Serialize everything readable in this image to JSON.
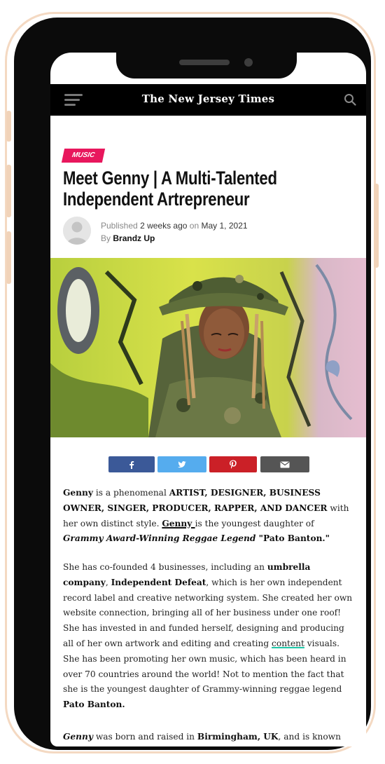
{
  "site": {
    "logo": "The New Jersey Times"
  },
  "article": {
    "category": "MUSIC",
    "title_line1": "Meet Genny | A Multi-Talented",
    "title_line2": "Independent Artrepreneur",
    "meta": {
      "published_prefix": "Published",
      "relative_time": "2 weeks ago",
      "on_word": "on",
      "date": "May 1, 2021",
      "by_prefix": "By",
      "author": "Brandz Up"
    },
    "share_buttons": [
      {
        "name": "facebook",
        "color": "#3b5998"
      },
      {
        "name": "twitter",
        "color": "#55acee"
      },
      {
        "name": "pinterest",
        "color": "#cb2027"
      },
      {
        "name": "email",
        "color": "#555555"
      }
    ],
    "p1": {
      "s1": "Genny",
      "s2": " is a phenomenal ",
      "s3": "ARTIST, DESIGNER, BUSINESS OWNER, SINGER, PRODUCER, RAPPER, AND DANCER",
      "s4": " with her own distinct style. ",
      "s5": "Genny ",
      "s6": "is the youngest daughter of ",
      "s7": "Grammy Award-Winning Reggae Legend",
      "s8": " \"Pato Banton.\""
    },
    "p2": {
      "s1": "She has co-founded 4 businesses, including an ",
      "s2": "umbrella company",
      "s3": ", ",
      "s4": "Independent Defeat",
      "s5": ", which is her own independent record label and creative networking system. She created her own website connection, bringing all of her business under one roof! She has invested in and funded herself, designing and producing all of her own artwork and editing and creating ",
      "s6": "content",
      "s7": " visuals. She has been promoting her own music, which has been heard in over 70 countries around the world! Not to mention the fact that she is the youngest daughter of Grammy-winning reggae legend ",
      "s8": "Pato Banton."
    },
    "p3": {
      "s1": "Genny",
      "s2": " was born and raised in ",
      "s3": "Birmingham, UK",
      "s4": ", and is known"
    }
  },
  "colors": {
    "badge": "#e8175d",
    "phone_frame": "#0b0b0b",
    "case_outline": "#f4d9c2",
    "link_underline_teal": "#1fc7a8"
  },
  "icons": [
    "hamburger-menu-icon",
    "search-icon",
    "user-avatar-icon",
    "facebook-icon",
    "twitter-icon",
    "pinterest-icon",
    "email-icon"
  ]
}
